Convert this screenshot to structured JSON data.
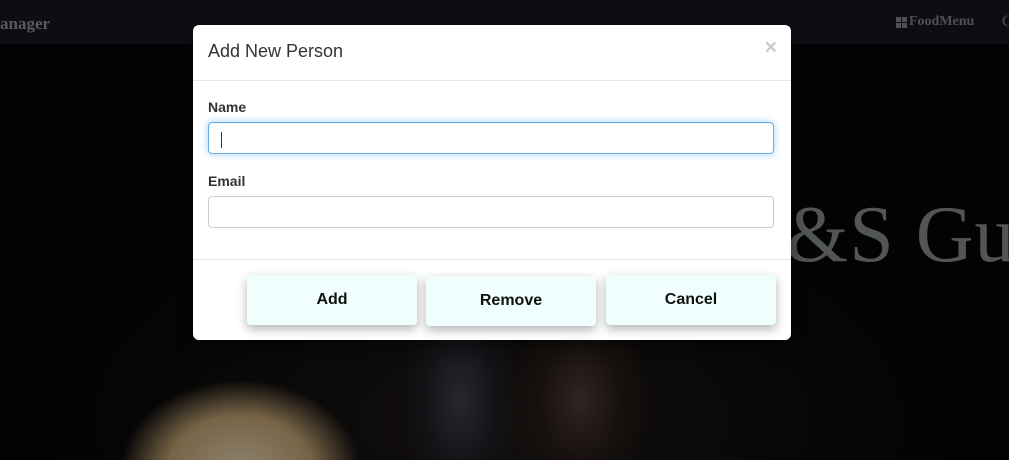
{
  "navbar": {
    "brand": "anager",
    "menu_item": "FoodMenu",
    "extra_glyph": "C"
  },
  "hero": {
    "text": "&S Gue"
  },
  "modal": {
    "title": "Add New Person",
    "close_glyph": "×",
    "fields": {
      "name": {
        "label": "Name",
        "value": "",
        "placeholder": ""
      },
      "email": {
        "label": "Email",
        "value": "",
        "placeholder": ""
      }
    },
    "buttons": {
      "add": "Add",
      "remove": "Remove",
      "cancel": "Cancel"
    }
  },
  "colors": {
    "button_bg": "#f0fffe",
    "focus_border": "#66afe9",
    "navbar_bg": "#16151f"
  }
}
